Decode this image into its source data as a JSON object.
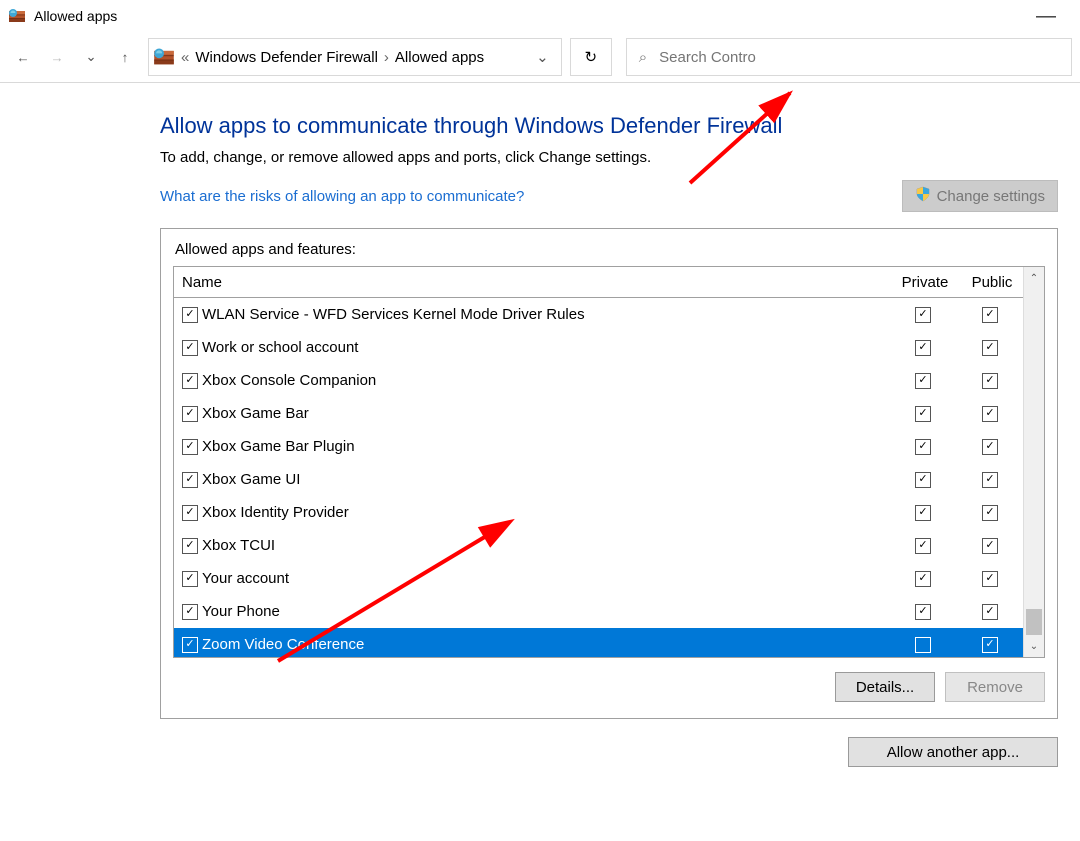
{
  "window": {
    "title": "Allowed apps",
    "minimize_glyph": "—"
  },
  "toolbar": {
    "back_glyph": "←",
    "forward_glyph": "→",
    "recent_glyph": "⌄",
    "up_glyph": "↑",
    "crumb_pre": "«",
    "crumb1": "Windows Defender Firewall",
    "crumb_sep": "›",
    "crumb2": "Allowed apps",
    "addr_drop_glyph": "⌄",
    "refresh_glyph": "↻",
    "search_icon": "⌕",
    "search_placeholder": "Search Contro"
  },
  "main": {
    "heading": "Allow apps to communicate through Windows Defender Firewall",
    "subtext": "To add, change, or remove allowed apps and ports, click Change settings.",
    "risk_link": "What are the risks of allowing an app to communicate?",
    "change_settings": "Change settings",
    "groupbox_label": "Allowed apps and features:",
    "col_name": "Name",
    "col_private": "Private",
    "col_public": "Public",
    "details_btn": "Details...",
    "remove_btn": "Remove",
    "allow_another": "Allow another app..."
  },
  "rows": [
    {
      "name": "WLAN Service - WFD Services Kernel Mode Driver Rules",
      "enabled": true,
      "private": true,
      "public": true,
      "selected": false
    },
    {
      "name": "Work or school account",
      "enabled": true,
      "private": true,
      "public": true,
      "selected": false
    },
    {
      "name": "Xbox Console Companion",
      "enabled": true,
      "private": true,
      "public": true,
      "selected": false
    },
    {
      "name": "Xbox Game Bar",
      "enabled": true,
      "private": true,
      "public": true,
      "selected": false
    },
    {
      "name": "Xbox Game Bar Plugin",
      "enabled": true,
      "private": true,
      "public": true,
      "selected": false
    },
    {
      "name": "Xbox Game UI",
      "enabled": true,
      "private": true,
      "public": true,
      "selected": false
    },
    {
      "name": "Xbox Identity Provider",
      "enabled": true,
      "private": true,
      "public": true,
      "selected": false
    },
    {
      "name": "Xbox TCUI",
      "enabled": true,
      "private": true,
      "public": true,
      "selected": false
    },
    {
      "name": "Your account",
      "enabled": true,
      "private": true,
      "public": true,
      "selected": false
    },
    {
      "name": "Your Phone",
      "enabled": true,
      "private": true,
      "public": true,
      "selected": false
    },
    {
      "name": "Zoom Video Conference",
      "enabled": true,
      "private": false,
      "public": true,
      "selected": true
    }
  ],
  "scroll": {
    "up_glyph": "⌃",
    "down_glyph": "⌄"
  }
}
